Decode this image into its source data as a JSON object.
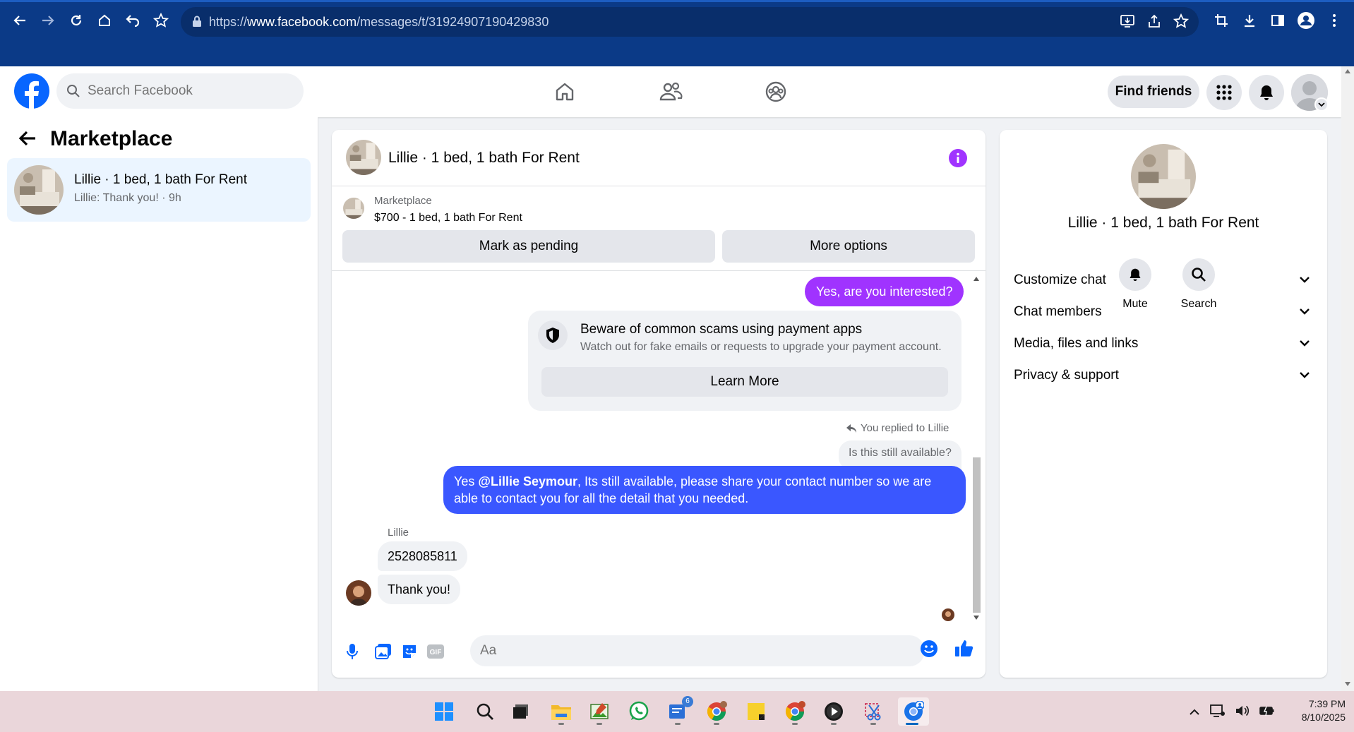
{
  "browser": {
    "url_prefix": "https://",
    "url_host": "www.facebook.com",
    "url_path": "/messages/t/31924907190429830"
  },
  "fb": {
    "search_placeholder": "Search Facebook",
    "find_friends_label": "Find friends"
  },
  "sidebar": {
    "title": "Marketplace",
    "conversation": {
      "name": "Lillie · 1 bed, 1 bath For Rent",
      "preview": "Lillie: Thank you! · 9h"
    }
  },
  "chat": {
    "title": "Lillie · 1 bed, 1 bath For Rent",
    "listing_source": "Marketplace",
    "listing_price": "$700 - 1 bed, 1 bath For Rent",
    "mark_pending_label": "Mark as pending",
    "more_options_label": "More options",
    "messages": {
      "me1": "Yes, are you interested?",
      "scam_title": "Beware of common scams using payment apps",
      "scam_sub": "Watch out for fake emails or requests to upgrade your payment account.",
      "learn_more_label": "Learn More",
      "replied_to": "You replied to Lillie",
      "quoted": "Is this still available?",
      "me2_prefix": "Yes",
      "me2_mention": "@Lillie Seymour",
      "me2_rest": ",  Its still available, please share your contact number so we are able to contact you for all the detail that you needed.",
      "sender_name": "Lillie",
      "them1": "2528085811",
      "them2": "Thank you!"
    },
    "composer_placeholder": "Aa"
  },
  "right_panel": {
    "title": "Lillie · 1 bed, 1 bath For Rent",
    "mute_label": "Mute",
    "search_label": "Search",
    "sections": [
      "Customize chat",
      "Chat members",
      "Media, files and links",
      "Privacy & support"
    ]
  },
  "taskbar": {
    "badge_count": "6",
    "time": "7:39 PM",
    "date": "8/10/2025"
  },
  "colors": {
    "accent_purple": "#a033ff",
    "accent_blue": "#3a57ff",
    "fb_blue": "#0866ff",
    "chrome_blue": "#0b3a87"
  }
}
